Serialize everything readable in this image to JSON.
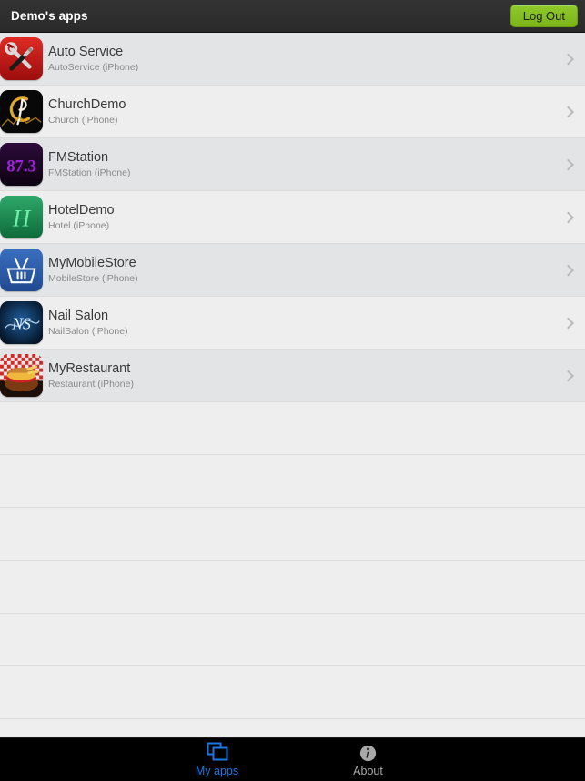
{
  "header": {
    "title": "Demo's apps",
    "logout_label": "Log Out",
    "background_color": "#2c2c2c",
    "logout_color": "#84c01b"
  },
  "list": {
    "empty_row_count": 7,
    "apps": [
      {
        "name": "Auto Service",
        "subtitle": "AutoService (iPhone)",
        "icon": "auto-service-icon",
        "accent": "#c41f1f"
      },
      {
        "name": "ChurchDemo",
        "subtitle": "Church (iPhone)",
        "icon": "church-icon",
        "accent": "#d9a520"
      },
      {
        "name": "FMStation",
        "subtitle": "FMStation (iPhone)",
        "icon": "fmstation-icon",
        "accent": "#8a1fd6",
        "icon_text": "87.3"
      },
      {
        "name": "HotelDemo",
        "subtitle": "Hotel (iPhone)",
        "icon": "hotel-icon",
        "accent": "#1f8a4c",
        "icon_text": "H"
      },
      {
        "name": "MyMobileStore",
        "subtitle": "MobileStore (iPhone)",
        "icon": "mobile-store-icon",
        "accent": "#2b5fad"
      },
      {
        "name": "Nail Salon",
        "subtitle": "NailSalon (iPhone)",
        "icon": "nail-salon-icon",
        "accent": "#0b2f66",
        "icon_text": "NS"
      },
      {
        "name": "MyRestaurant",
        "subtitle": "Restaurant (iPhone)",
        "icon": "restaurant-icon",
        "accent": "#b52b2b"
      }
    ]
  },
  "tabbar": {
    "tabs": [
      {
        "label": "My apps",
        "icon": "apps-stack-icon",
        "active": true,
        "color": "#1b78e0"
      },
      {
        "label": "About",
        "icon": "info-circle-icon",
        "active": false,
        "color": "#a8a8a8"
      }
    ]
  }
}
